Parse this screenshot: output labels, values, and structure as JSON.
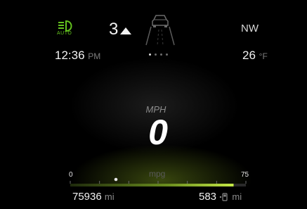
{
  "status_bar": {
    "headlight_mode": "AUTO",
    "gear_number": "3",
    "compass_heading": "NW"
  },
  "info_row": {
    "time": "12:36",
    "time_suffix": "PM",
    "page_count": 4,
    "active_page": 1,
    "temperature": "26",
    "temperature_unit": "°F"
  },
  "speed": {
    "unit": "MPH",
    "value": "0"
  },
  "fuel_economy": {
    "label": "mpg",
    "min_label": "0",
    "max_label": "75",
    "current_level": 0.26,
    "average_level": 0.93
  },
  "trip": {
    "odometer_value": "75936",
    "odometer_unit": "mi",
    "range_value": "583",
    "range_unit": "mi"
  },
  "colors": {
    "indicator_green": "#63c21e",
    "text_primary": "#f2f2f2",
    "text_secondary": "#7c7c7c",
    "gauge_green": "#b8e03a"
  },
  "icons": {
    "headlight": "headlight-auto-icon",
    "lane": "lane-car-icon",
    "fuel": "fuel-pump-icon"
  }
}
